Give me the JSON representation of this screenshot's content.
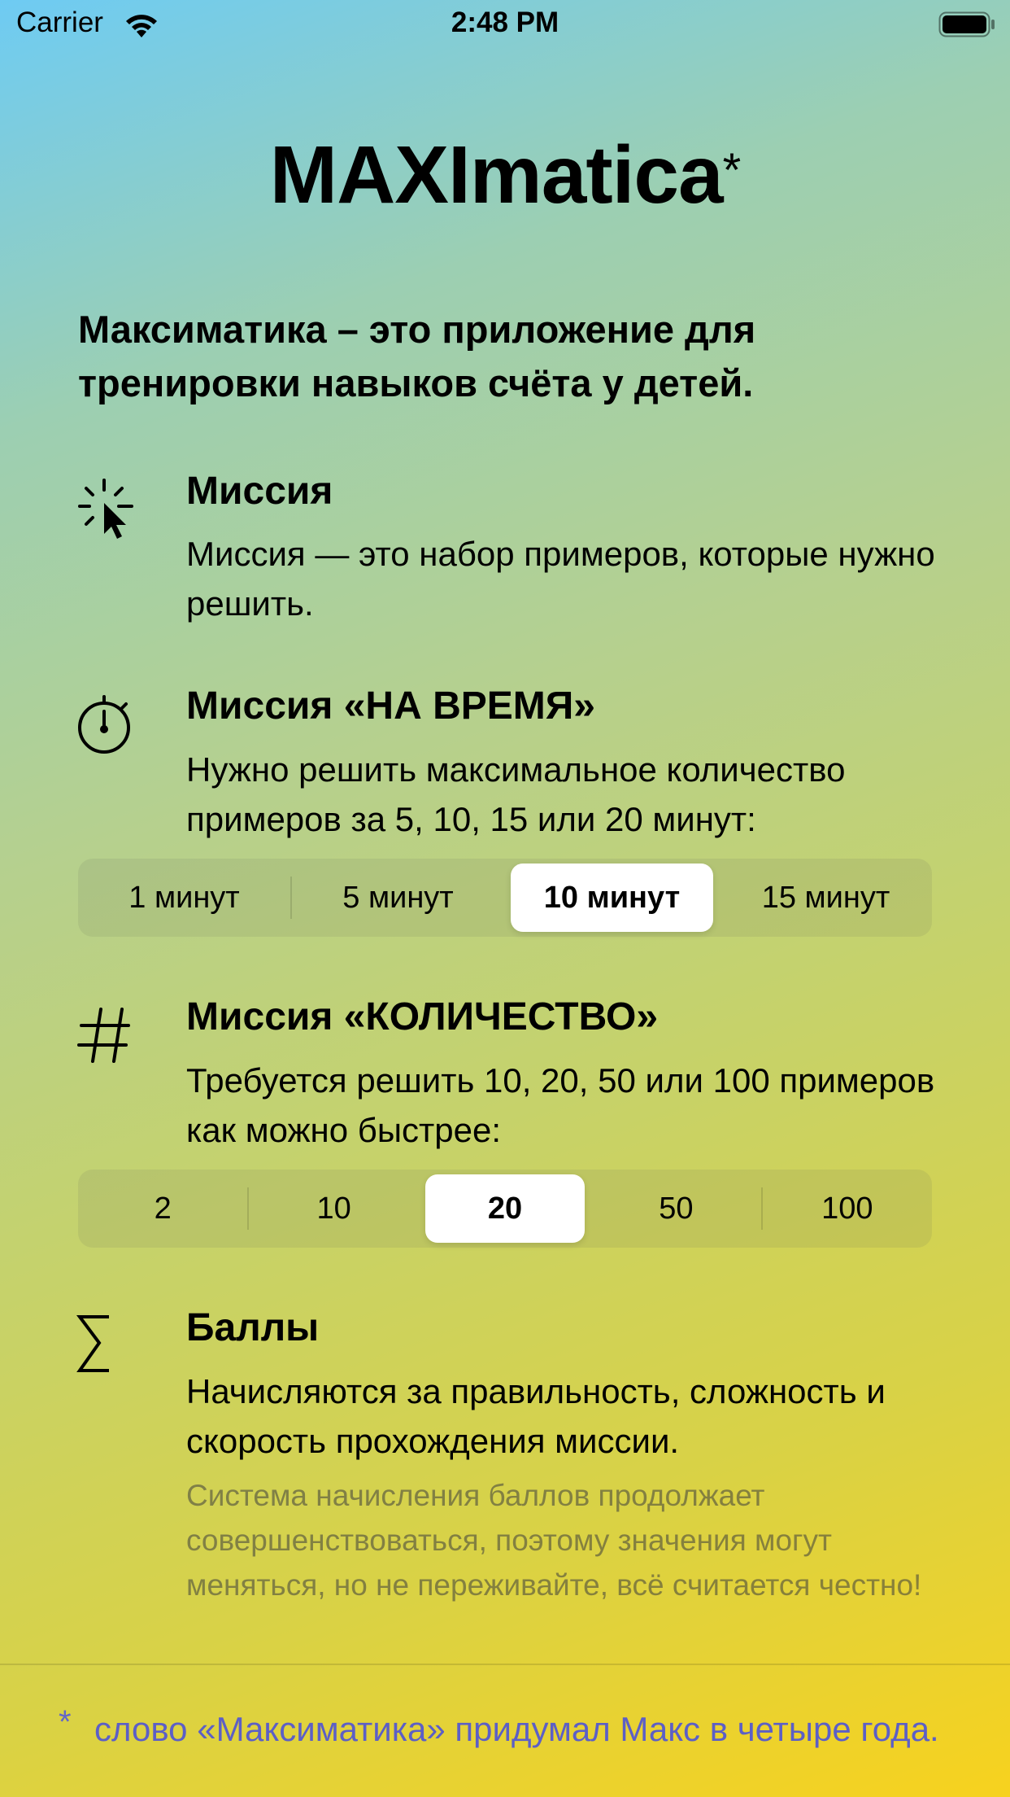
{
  "status_bar": {
    "carrier": "Carrier",
    "time": "2:48 PM"
  },
  "title": "MAXImatica",
  "title_star": "*",
  "intro": "Максиматика – это приложение для тренировки навыков счёта у детей.",
  "sections": {
    "mission": {
      "icon": "pointer-click-icon",
      "title": "Миссия",
      "description": "Миссия — это набор примеров, которые нужно решить."
    },
    "timed": {
      "icon": "stopwatch-icon",
      "title": "Миссия «НА ВРЕМЯ»",
      "description": "Нужно решить максимальное количество примеров за 5, 10, 15 или 20 минут:",
      "options": [
        "1 минут",
        "5 минут",
        "10 минут",
        "15 минут"
      ],
      "selected": "10 минут"
    },
    "count": {
      "icon": "hash-icon",
      "title": "Миссия «КОЛИЧЕСТВО»",
      "description": "Требуется решить 10, 20, 50 или 100 примеров как можно быстрее:",
      "options": [
        "2",
        "10",
        "20",
        "50",
        "100"
      ],
      "selected": "20"
    },
    "points": {
      "icon": "sigma-icon",
      "title": "Баллы",
      "description": "Начисляются за правильность, сложность и скорость прохождения миссии.",
      "note": "Система начисления баллов продолжает совершенствоваться, поэтому значения могут меняться, но не переживайте, всё считается честно!"
    }
  },
  "footnote": {
    "star": "*",
    "text": "слово «Максиматика» придумал Макс в четыре года."
  },
  "colors": {
    "footnote": "#5c5fc6",
    "selected_segment": "#ffffff"
  }
}
